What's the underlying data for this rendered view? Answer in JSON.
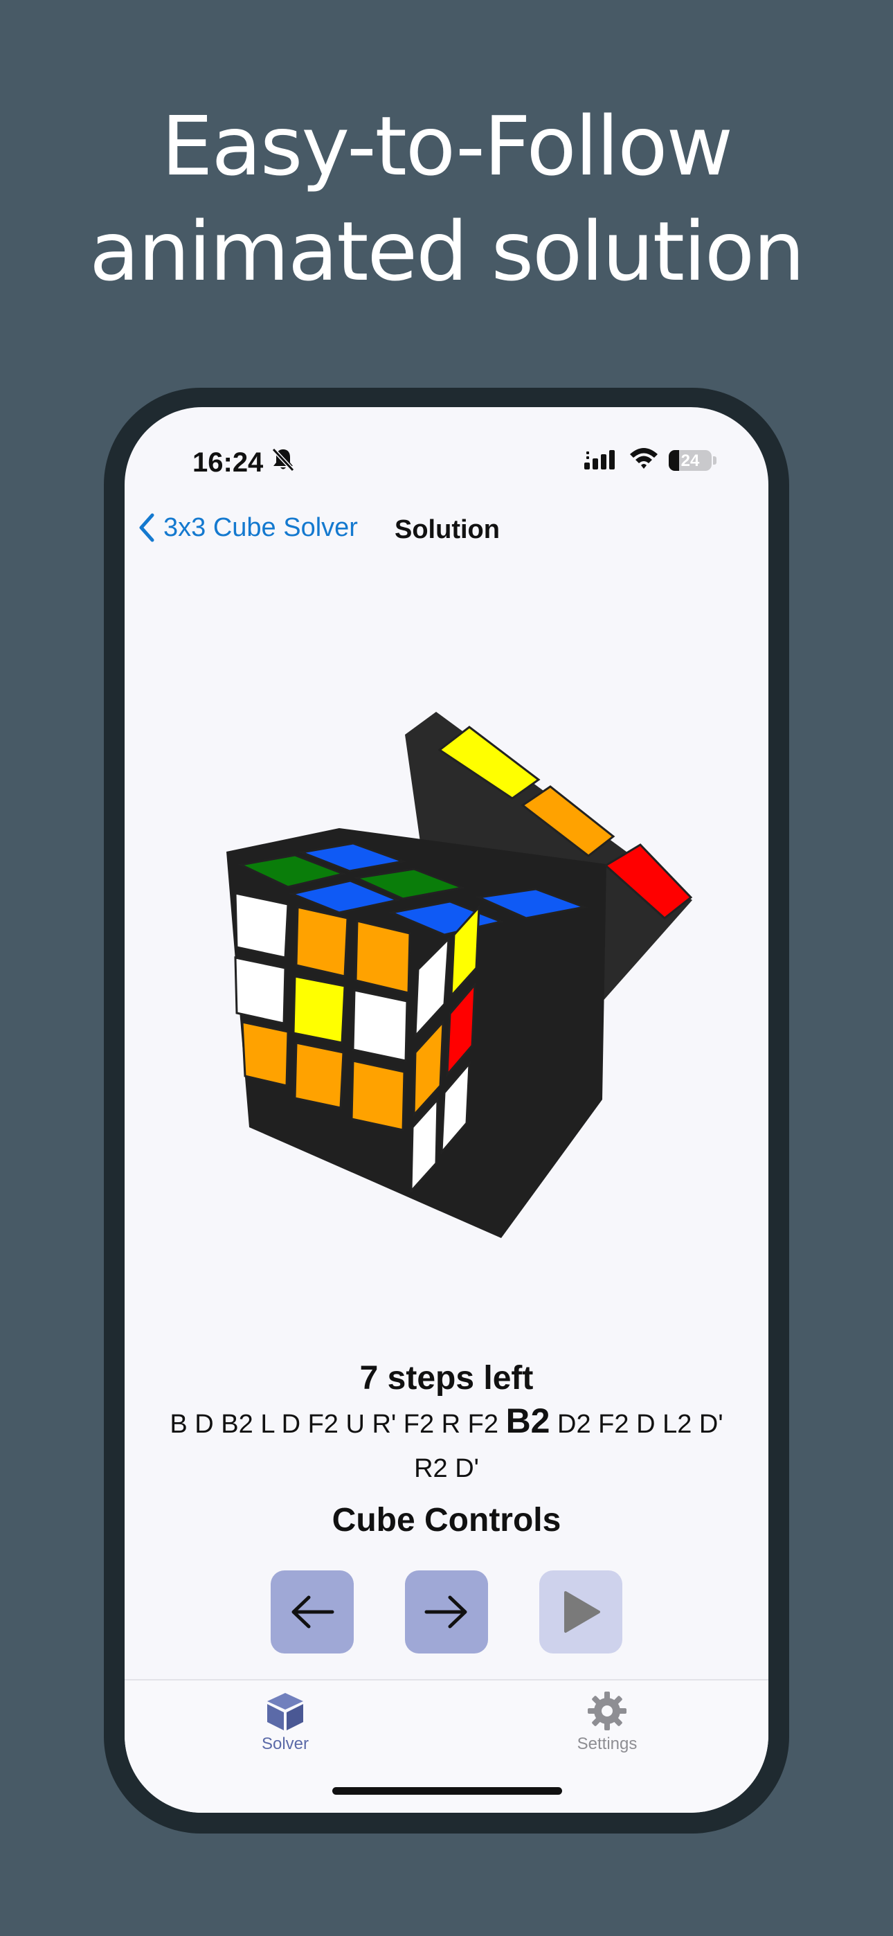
{
  "headline": {
    "line1": "Easy-to-Follow",
    "line2": "animated solution"
  },
  "status_bar": {
    "time": "16:24",
    "battery": "24",
    "muted_icon": "bell-slash-icon"
  },
  "nav": {
    "back_label": "3x3 Cube Solver",
    "title": "Solution"
  },
  "solution": {
    "steps_left": "7 steps left",
    "moves_before": "B D B2 L D F2 U R' F2 R F2 ",
    "current_move": "B2",
    "moves_after": " D2 F2 D L2 D' R2 D'"
  },
  "controls": {
    "title": "Cube Controls",
    "buttons": [
      {
        "icon": "arrow-left-icon",
        "enabled": true
      },
      {
        "icon": "arrow-right-icon",
        "enabled": true
      },
      {
        "icon": "play-icon",
        "enabled": false
      }
    ]
  },
  "tabs": [
    {
      "label": "Solver",
      "icon": "cube-icon",
      "selected": true
    },
    {
      "label": "Settings",
      "icon": "gear-icon",
      "selected": false
    }
  ],
  "colors": {
    "accent": "#1479cf",
    "tab_selected": "#5b6aa8",
    "tab_unselected": "#8e8e93",
    "cube_white": "#ffffff",
    "cube_orange": "#ffa200",
    "cube_yellow": "#ffff00",
    "cube_blue": "#0f5af5",
    "cube_green": "#0a7d0a",
    "cube_red": "#ff0000"
  }
}
